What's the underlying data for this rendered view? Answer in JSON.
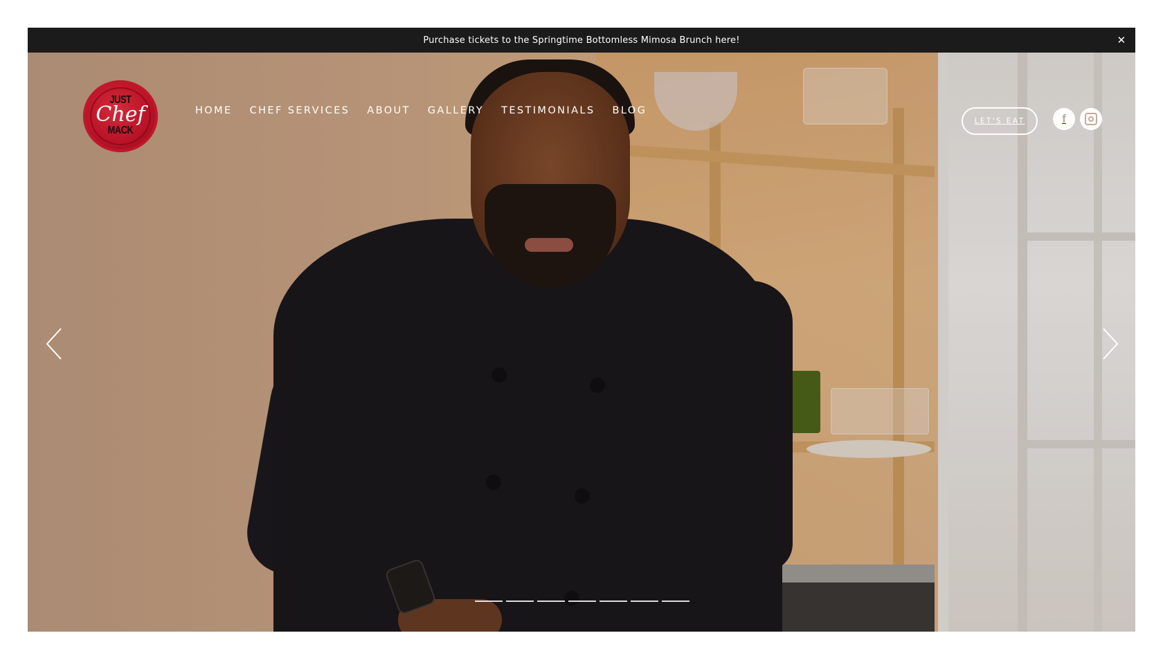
{
  "announcement": {
    "text": "Purchase tickets to the Springtime Bottomless Mimosa Brunch here!",
    "close_glyph": "✕"
  },
  "logo": {
    "line1": "JUST",
    "line2": "Chef",
    "line3": "MACK",
    "color": "#b91327"
  },
  "nav": {
    "items": [
      "HOME",
      "CHEF SERVICES",
      "ABOUT",
      "GALLERY",
      "TESTIMONIALS",
      "BLOG"
    ]
  },
  "cta": {
    "label": "LET'S EAT"
  },
  "social": {
    "facebook": {
      "icon": "facebook-icon",
      "glyph": "f"
    },
    "instagram": {
      "icon": "instagram-icon"
    }
  },
  "slider": {
    "prev_icon": "chevron-left-icon",
    "next_icon": "chevron-right-icon",
    "slide_count": 7
  }
}
